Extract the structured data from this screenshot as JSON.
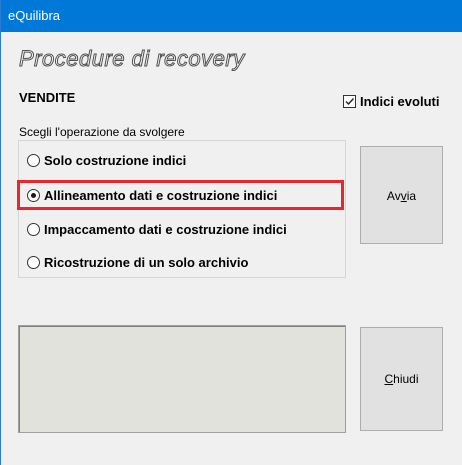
{
  "window": {
    "title": "eQuilibra"
  },
  "header": {
    "title": "Procedure di recovery",
    "section": "VENDITE"
  },
  "options": {
    "advanced_indexes_label": "Indici evoluti",
    "advanced_indexes_checked": true
  },
  "group": {
    "label": "Scegli l'operazione da svolgere",
    "radios": [
      {
        "label": "Solo costruzione indici",
        "selected": false
      },
      {
        "label": "Allineamento dati e costruzione indici",
        "selected": true
      },
      {
        "label": "Impaccamento dati e costruzione indici",
        "selected": false
      },
      {
        "label": "Ricostruzione di un solo archivio",
        "selected": false
      }
    ]
  },
  "buttons": {
    "run": {
      "pre": "Av",
      "accel": "v",
      "post": "ia"
    },
    "close": {
      "pre": "",
      "accel": "C",
      "post": "hiudi"
    }
  },
  "colors": {
    "titlebar": "#0078d7",
    "highlight": "#e8262d"
  }
}
